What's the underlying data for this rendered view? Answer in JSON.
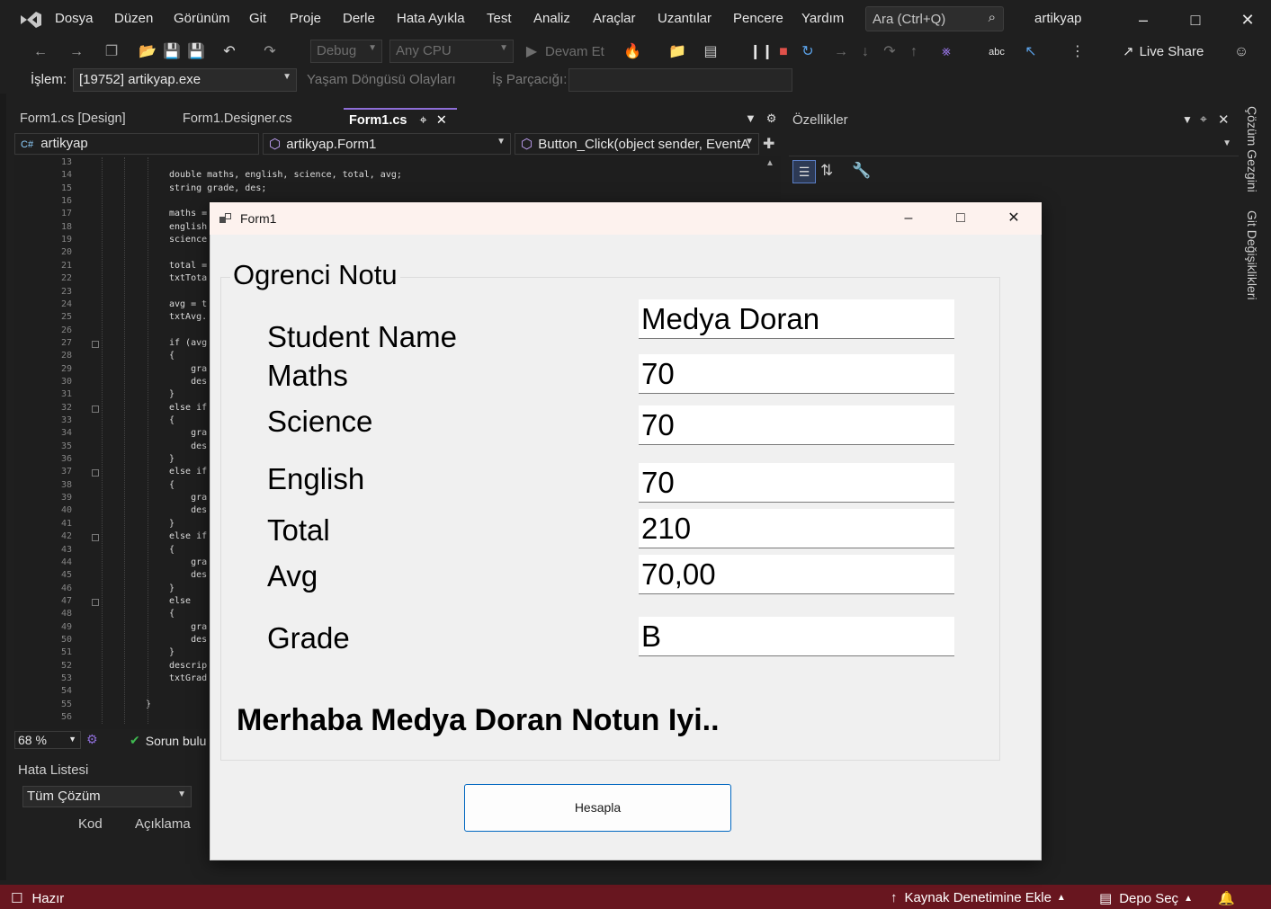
{
  "menu": {
    "items": [
      "Dosya",
      "Düzen",
      "Görünüm",
      "Git",
      "Proje",
      "Derle",
      "Hata Ayıkla",
      "Test",
      "Analiz",
      "Araçlar",
      "Uzantılar",
      "Pencere",
      "Yardım"
    ],
    "search_placeholder": "Ara (Ctrl+Q)",
    "solution_name": "artikyap"
  },
  "toolbar": {
    "config": "Debug",
    "platform": "Any CPU",
    "continue_label": "Devam Et",
    "live_share": "Live Share"
  },
  "debug_toolbar": {
    "process_label": "İşlem:",
    "process_value": "[19752] artikyap.exe",
    "lifecycle_label": "Yaşam Döngüsü Olayları",
    "thread_label": "İş Parçacığı:"
  },
  "doc_tabs": [
    {
      "label": "Form1.cs [Design]"
    },
    {
      "label": "Form1.Designer.cs"
    },
    {
      "label": "Form1.cs"
    }
  ],
  "nav_bar": {
    "project": "artikyap",
    "class": "artikyap.Form1",
    "member": "Button_Click(object sender, EventA"
  },
  "code": {
    "line_numbers": [
      "13",
      "14",
      "15",
      "16",
      "17",
      "18",
      "19",
      "20",
      "21",
      "22",
      "23",
      "24",
      "25",
      "26",
      "27",
      "28",
      "29",
      "30",
      "31",
      "32",
      "33",
      "34",
      "35",
      "36",
      "37",
      "38",
      "39",
      "40",
      "41",
      "42",
      "43",
      "44",
      "45",
      "46",
      "47",
      "48",
      "49",
      "50",
      "51",
      "52",
      "53",
      "54",
      "55",
      "56"
    ],
    "lines": [
      "",
      "double maths, english, science, total, avg;",
      "string grade, des;",
      "",
      "maths =",
      "english",
      "science",
      "",
      "total =",
      "txtTota",
      "",
      "avg = t",
      "txtAvg.",
      "",
      "if (avg",
      "{",
      "    gra",
      "    des",
      "}",
      "else if",
      "{",
      "    gra",
      "    des",
      "}",
      "else if",
      "{",
      "    gra",
      "    des",
      "}",
      "else if",
      "{",
      "    gra",
      "    des",
      "}",
      "else",
      "{",
      "    gra",
      "    des",
      "}",
      "descrip",
      "txtGrad",
      "",
      "}",
      ""
    ]
  },
  "editor_status": {
    "zoom": "68 %",
    "issues": "Sorun bulu"
  },
  "error_list": {
    "title": "Hata Listesi",
    "filter": "Tüm Çözüm",
    "columns": [
      "Kod",
      "Açıklama"
    ]
  },
  "properties": {
    "title": "Özellikler"
  },
  "right_rail": [
    "Çözüm Gezgini",
    "Git Değişiklikleri"
  ],
  "statusbar": {
    "ready": "Hazır",
    "source_control": "Kaynak Denetimine Ekle",
    "repo": "Depo Seç"
  },
  "form1": {
    "title": "Form1",
    "group_title": "Ogrenci Notu",
    "fields": [
      {
        "label": "Student Name",
        "value": "Medya Doran"
      },
      {
        "label": "Maths",
        "value": "70"
      },
      {
        "label": "Science",
        "value": "70"
      },
      {
        "label": "English",
        "value": "70"
      },
      {
        "label": "Total",
        "value": "210"
      },
      {
        "label": "Avg",
        "value": "70,00"
      },
      {
        "label": "Grade",
        "value": "B"
      }
    ],
    "message": "Merhaba Medya Doran Notun Iyi..",
    "button": "Hesapla"
  },
  "colors": {
    "accent": "#8e6ed8",
    "statusbar": "#68161f",
    "button_border": "#0067c0"
  }
}
